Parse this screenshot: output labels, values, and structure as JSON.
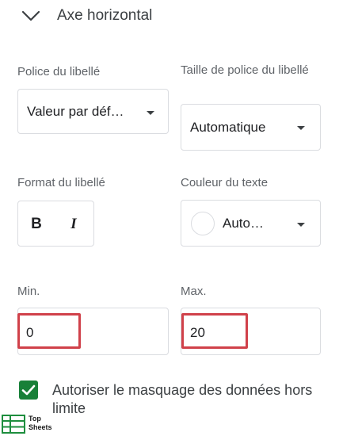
{
  "section": {
    "title": "Axe horizontal",
    "chevron_icon": "chevron-down-icon"
  },
  "font_label": {
    "label": "Police du libellé",
    "value": "Valeur par déf…"
  },
  "font_size": {
    "label": "Taille de police du libellé",
    "value": "Automatique"
  },
  "label_format": {
    "label": "Format du libellé",
    "bold_glyph": "B",
    "italic_glyph": "I"
  },
  "text_color": {
    "label": "Couleur du texte",
    "value": "Auto…",
    "swatch_color": "#ffffff"
  },
  "min": {
    "label": "Min.",
    "value": "0"
  },
  "max": {
    "label": "Max.",
    "value": "20"
  },
  "allow_hidden": {
    "label": "Autoriser le masquage des données hors limite",
    "checked": true
  },
  "watermark": {
    "line1": "Top",
    "line2": "Sheets"
  },
  "colors": {
    "highlight": "#d0414a",
    "checkbox": "#188038",
    "border": "#dadce0"
  }
}
